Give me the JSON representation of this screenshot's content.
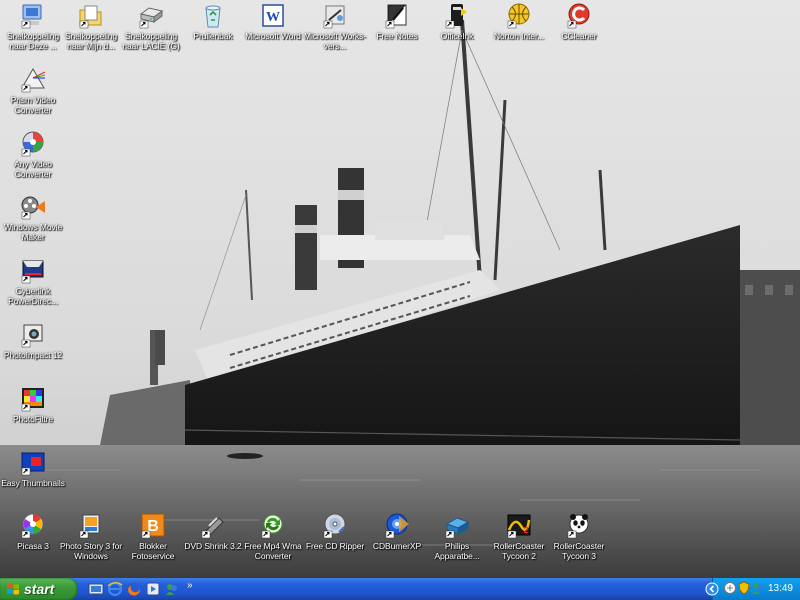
{
  "desktop": {
    "icons": [
      {
        "label": "Snelkoppeling naar Deze ..."
      },
      {
        "label": "Snelkoppeling naar Mijn d..."
      },
      {
        "label": "Snelkoppeling naar LACIE (G)"
      },
      {
        "label": "Prullenbak"
      },
      {
        "label": "Microsoft Word"
      },
      {
        "label": "Microsoft Works-vers..."
      },
      {
        "label": "Free Notes"
      },
      {
        "label": "OfficeInk"
      },
      {
        "label": "Norton Inter..."
      },
      {
        "label": "CCleaner"
      },
      {
        "label": "Prism Video Converter"
      },
      {
        "label": "Any Video Converter"
      },
      {
        "label": "Windows Movie Maker"
      },
      {
        "label": "Cyberlink PowerDirec..."
      },
      {
        "label": "PhotoImpact 12"
      },
      {
        "label": "PhotoFiltre"
      },
      {
        "label": "Easy Thumbnails"
      },
      {
        "label": "Picasa 3"
      },
      {
        "label": "Photo Story 3 for Windows"
      },
      {
        "label": "Blokker Fotoservice"
      },
      {
        "label": "DVD Shrink 3.2"
      },
      {
        "label": "Free Mp4 Wma Converter"
      },
      {
        "label": "Free CD Ripper"
      },
      {
        "label": "CDBurnerXP"
      },
      {
        "label": "Philips Apparatbe..."
      },
      {
        "label": "RollerCoaster Tycoon 2"
      },
      {
        "label": "RollerCoaster Tycoon 3"
      }
    ]
  },
  "taskbar": {
    "start_label": "start",
    "chevron": "»",
    "clock": "13:49"
  },
  "colors": {
    "taskbar_blue": "#245edb",
    "start_green": "#3c9a3a",
    "tray_blue": "#0c8ee0"
  }
}
